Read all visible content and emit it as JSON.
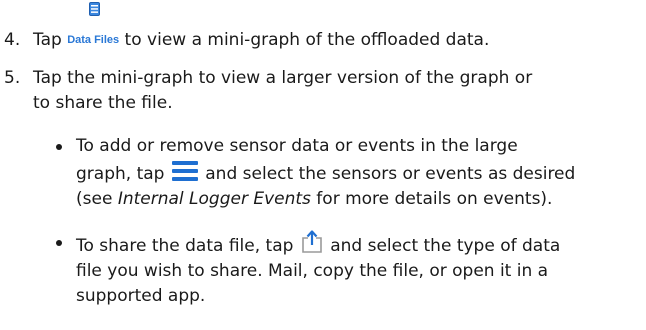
{
  "icons": {
    "top_icon": "document-server-icon",
    "menu_icon": "hamburger-menu-icon",
    "share_icon": "share-icon",
    "accent_color": "#2a78d6"
  },
  "steps": [
    {
      "number": "4.",
      "prefix": "Tap ",
      "button_label": "Data Files",
      "suffix": " to view a mini-graph of the offloaded data."
    },
    {
      "number": "5.",
      "line1": "Tap the mini-graph to view a larger version of the graph or",
      "line2": "to share the file."
    }
  ],
  "bullets": [
    {
      "line1": "To add or remove sensor data or events in the large",
      "line2_prefix": "graph, tap ",
      "line2_suffix": " and select the sensors or events as desired",
      "line3_prefix": "(see ",
      "line3_italic": "Internal Logger Events",
      "line3_suffix": " for more details on events)."
    },
    {
      "line1_prefix": "To share the data file, tap ",
      "line1_suffix": " and select the type of data",
      "line2": "file you wish to share. Mail, copy the file, or open it in a",
      "line3": "supported app."
    }
  ]
}
